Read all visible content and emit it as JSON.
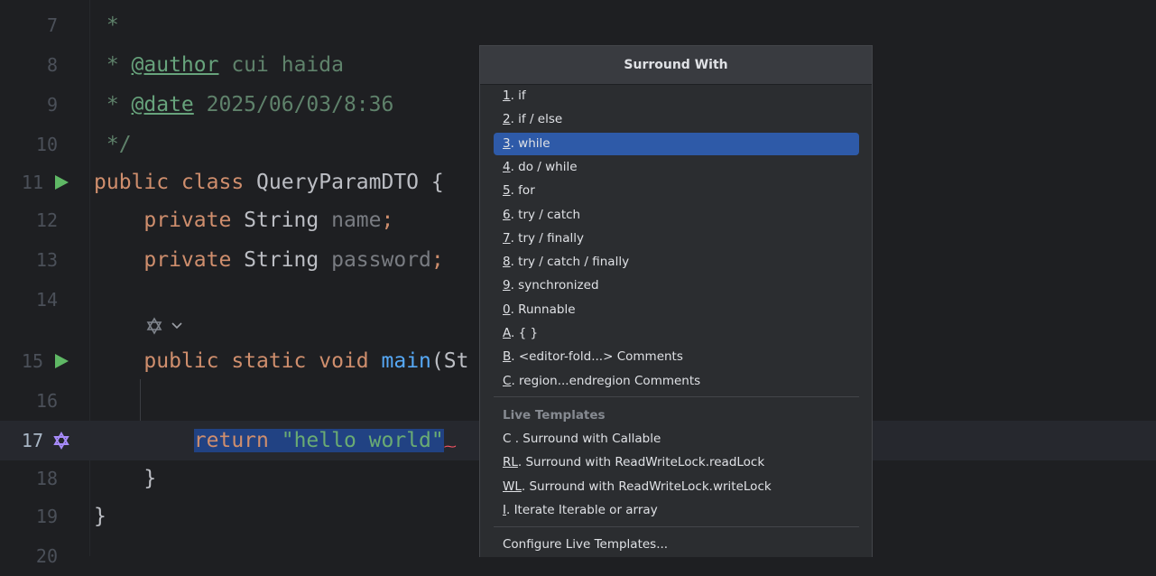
{
  "editor": {
    "lines": [
      {
        "num": "7",
        "tokens": [
          {
            "text": " *",
            "cls": "cm"
          }
        ]
      },
      {
        "num": "8",
        "tokens": [
          {
            "text": " * ",
            "cls": "cm"
          },
          {
            "text": "@author",
            "cls": "tag"
          },
          {
            "text": " cui haida",
            "cls": "cm"
          }
        ]
      },
      {
        "num": "9",
        "tokens": [
          {
            "text": " * ",
            "cls": "cm"
          },
          {
            "text": "@date",
            "cls": "tag"
          },
          {
            "text": " 2025/06/03/8:36",
            "cls": "cm"
          }
        ]
      },
      {
        "num": "10",
        "tokens": [
          {
            "text": " */",
            "cls": "cm"
          }
        ]
      },
      {
        "num": "11",
        "tokens": [
          {
            "text": "public class ",
            "cls": "kw"
          },
          {
            "text": "QueryParamDTO {",
            "cls": ""
          }
        ]
      },
      {
        "num": "12",
        "tokens": [
          {
            "text": "    private ",
            "cls": "kw"
          },
          {
            "text": "String ",
            "cls": ""
          },
          {
            "text": "name",
            "cls": "fld"
          },
          {
            "text": ";",
            "cls": "kw"
          }
        ]
      },
      {
        "num": "13",
        "tokens": [
          {
            "text": "    private ",
            "cls": "kw"
          },
          {
            "text": "String ",
            "cls": ""
          },
          {
            "text": "password",
            "cls": "fld"
          },
          {
            "text": ";",
            "cls": "kw"
          }
        ]
      },
      {
        "num": "14",
        "tokens": []
      },
      {
        "num": "15",
        "tokens": [
          {
            "text": "    public static void ",
            "cls": "kw"
          },
          {
            "text": "main",
            "cls": "fn"
          },
          {
            "text": "(St",
            "cls": ""
          }
        ]
      },
      {
        "num": "16",
        "tokens": []
      },
      {
        "num": "17",
        "tokens": [
          {
            "text": "        ",
            "cls": ""
          },
          {
            "text": "return ",
            "cls": "kw sel-block"
          },
          {
            "text": "\"hello world\"",
            "cls": "str sel-block"
          }
        ]
      },
      {
        "num": "18",
        "tokens": [
          {
            "text": "    }",
            "cls": ""
          }
        ]
      },
      {
        "num": "19",
        "tokens": [
          {
            "text": "}",
            "cls": ""
          }
        ]
      },
      {
        "num": "20",
        "tokens": []
      }
    ]
  },
  "popup": {
    "title": "Surround With",
    "items": [
      {
        "mn": "1",
        "rest": ". if"
      },
      {
        "mn": "2",
        "rest": ". if / else"
      },
      {
        "mn": "3",
        "rest": ". while"
      },
      {
        "mn": "4",
        "rest": ". do / while"
      },
      {
        "mn": "5",
        "rest": ". for"
      },
      {
        "mn": "6",
        "rest": ". try / catch"
      },
      {
        "mn": "7",
        "rest": ". try / finally"
      },
      {
        "mn": "8",
        "rest": ". try / catch / finally"
      },
      {
        "mn": "9",
        "rest": ". synchronized"
      },
      {
        "mn": "0",
        "rest": ". Runnable"
      },
      {
        "mn": "A",
        "rest": ". { }"
      },
      {
        "mn": "B",
        "rest": ". <editor-fold...> Comments"
      },
      {
        "mn": "C",
        "rest": ". region...endregion Comments"
      }
    ],
    "selected_item": "3. while",
    "live_templates_label": "Live Templates",
    "live_templates": [
      {
        "mn": "",
        "rest": "C . Surround with Callable"
      },
      {
        "mn": "RL",
        "rest": ". Surround with ReadWriteLock.readLock"
      },
      {
        "mn": "WL",
        "rest": ". Surround with ReadWriteLock.writeLock"
      },
      {
        "mn": "I",
        "rest": ". Iterate Iterable or array"
      }
    ],
    "configure_label": "Configure Live Templates..."
  },
  "icons": {
    "run_gutter": "run-triangle-icon",
    "ai_assistant": "ai-assistant-icon",
    "chevron": "chevron-down-icon"
  },
  "colors": {
    "background": "#1e1f22",
    "selection": "#2e5aa8",
    "code_selection": "#214283",
    "run_icon": "#5fb865",
    "ai_icon": "#a78bfa"
  }
}
